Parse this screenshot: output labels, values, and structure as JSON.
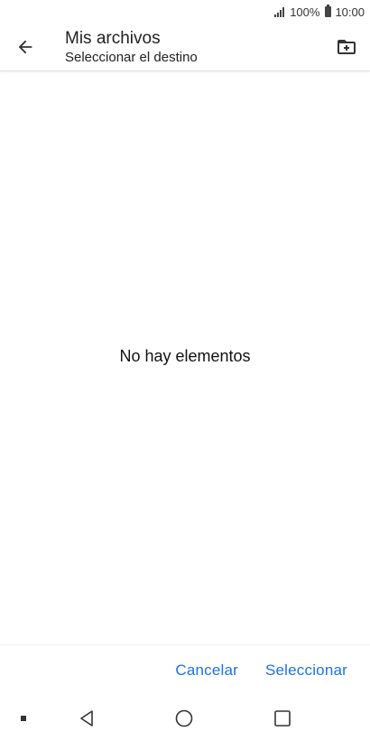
{
  "status_bar": {
    "battery_percent": "100%",
    "time": "10:00"
  },
  "app_bar": {
    "title": "Mis archivos",
    "subtitle": "Seleccionar el destino",
    "back_icon": "arrow-back-icon",
    "new_folder_icon": "create-new-folder-icon"
  },
  "content": {
    "empty_message": "No hay elementos"
  },
  "footer": {
    "cancel_label": "Cancelar",
    "select_label": "Seleccionar"
  },
  "colors": {
    "accent": "#1a73e8",
    "text": "#202124"
  }
}
